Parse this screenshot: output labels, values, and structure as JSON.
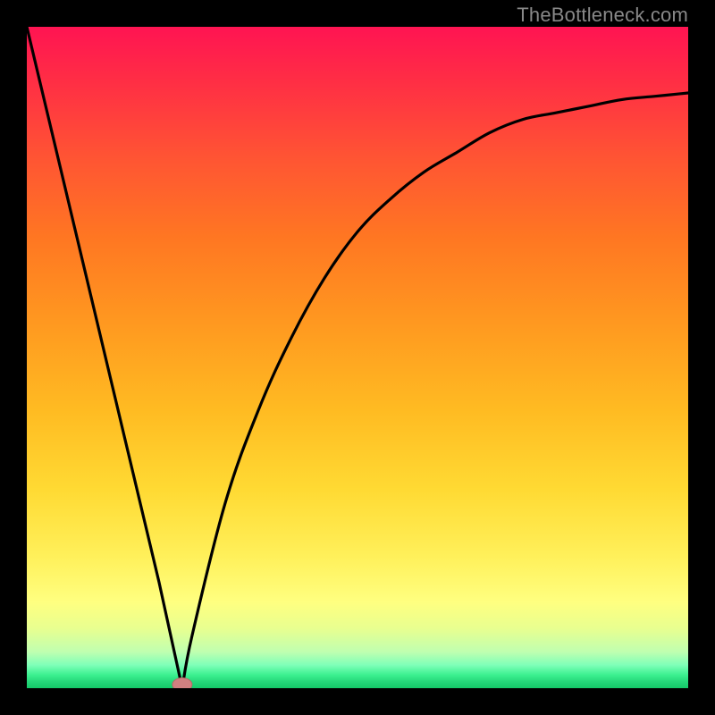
{
  "watermark": "TheBottleneck.com",
  "chart_data": {
    "type": "line",
    "title": "",
    "xlabel": "",
    "ylabel": "",
    "xlim": [
      0,
      1
    ],
    "ylim": [
      0,
      1
    ],
    "grid": false,
    "legend": false,
    "series": [
      {
        "name": "bottleneck-curve",
        "x": [
          0.0,
          0.05,
          0.1,
          0.15,
          0.2,
          0.235,
          0.25,
          0.3,
          0.35,
          0.4,
          0.45,
          0.5,
          0.55,
          0.6,
          0.65,
          0.7,
          0.75,
          0.8,
          0.85,
          0.9,
          0.95,
          1.0
        ],
        "y": [
          1.0,
          0.79,
          0.58,
          0.37,
          0.16,
          0.0,
          0.08,
          0.28,
          0.42,
          0.53,
          0.62,
          0.69,
          0.74,
          0.78,
          0.81,
          0.84,
          0.86,
          0.87,
          0.88,
          0.89,
          0.895,
          0.9
        ],
        "note": "y is bottleneck fraction (0 at green bottom, 1 at red top); min at x≈0.235"
      }
    ],
    "marker": {
      "name": "optimal-point",
      "x": 0.235,
      "y": 0.0,
      "color": "#d08080"
    },
    "colors": {
      "curve": "#000000",
      "marker_fill": "#d08080",
      "marker_stroke": "#b86868",
      "gradient_top": "#ff1452",
      "gradient_bottom": "#14c868"
    }
  }
}
